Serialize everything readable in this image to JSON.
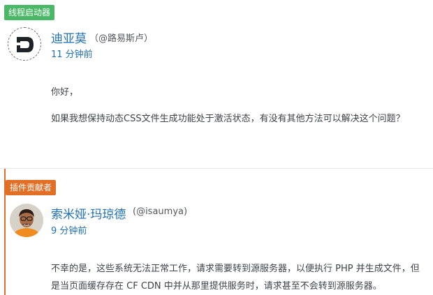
{
  "thread_starter": {
    "badge": "线程启动器",
    "badge_color": "#4ab866",
    "author_name": "迪亚莫",
    "author_handle": "（@路易斯卢）",
    "time_ago": "11 分钟前",
    "greeting": "你好，",
    "message": "如果我想保持动态CSS文件生成功能处于激活状态，有没有其他方法可以解决这个问题？"
  },
  "reply": {
    "badge": "插件贡献者",
    "badge_color": "#e26f26",
    "author_name": "索米娅·玛琼德",
    "author_handle": "(@isaumya)",
    "time_ago": "9 分钟前",
    "message": "不幸的是，这些系统无法正常工作，请求需要转到源服务器，以便执行 PHP 并生成文件，但是当页面缓存存在 CF CDN 中并从那里提供服务时，请求甚至不会转到源服务器。"
  },
  "icons": {
    "starter_avatar": "logo-avatar",
    "reply_avatar": "person-photo-avatar"
  }
}
